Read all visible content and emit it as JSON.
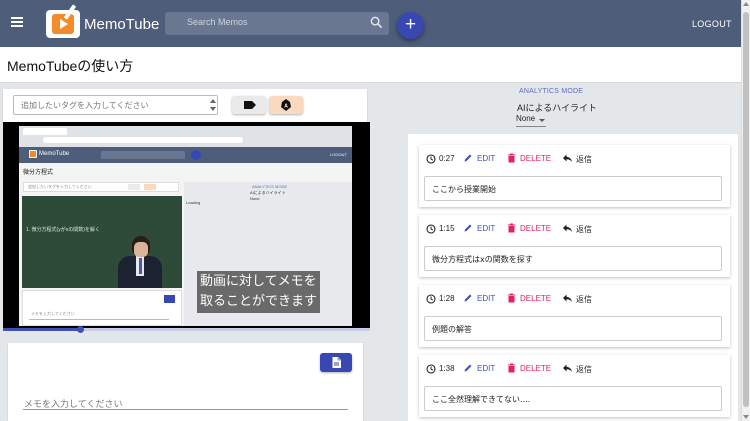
{
  "app": {
    "name": "MemoTube",
    "logout_label": "LOGOUT",
    "accent": "#4e5d7a",
    "primary": "#3947b3"
  },
  "search": {
    "placeholder": "Search Memos"
  },
  "fab": {
    "label": "+"
  },
  "page": {
    "title": "MemoTubeの使い方"
  },
  "tags": {
    "placeholder": "追加したいタグを入力してください"
  },
  "video": {
    "caption_line1": "動画に対してメモを",
    "caption_line2": "取ることができます",
    "progress_fraction": 0.21,
    "inner": {
      "app_name": "MemoTube",
      "logout_label": "LOGOUT",
      "title": "微分方程式",
      "tag_placeholder": "追加したいタグを入力してください",
      "chalk_text": "1. 微分方程式(yがxの関数)を解く",
      "memo_placeholder": "メモを入力してください",
      "analytics_mode": "ANALYTICS MODE",
      "ai_label": "AIによるハイライト",
      "ai_value": "None",
      "loading": "Loading"
    }
  },
  "memo_input": {
    "placeholder": "メモを入力してください"
  },
  "analytics": {
    "mode_label": "ANALYTICS MODE",
    "ai_label": "AIによるハイライト",
    "ai_value": "None"
  },
  "notes": [
    {
      "time": "0:27",
      "edit": "EDIT",
      "delete": "DELETE",
      "reply": "返信",
      "text": "ここから授業開始"
    },
    {
      "time": "1:15",
      "edit": "EDIT",
      "delete": "DELETE",
      "reply": "返信",
      "text": "微分方程式はxの関数を探す"
    },
    {
      "time": "1:28",
      "edit": "EDIT",
      "delete": "DELETE",
      "reply": "返信",
      "text": "例題の解答"
    },
    {
      "time": "1:38",
      "edit": "EDIT",
      "delete": "DELETE",
      "reply": "返信",
      "text": "ここ全然理解できてない...."
    }
  ]
}
